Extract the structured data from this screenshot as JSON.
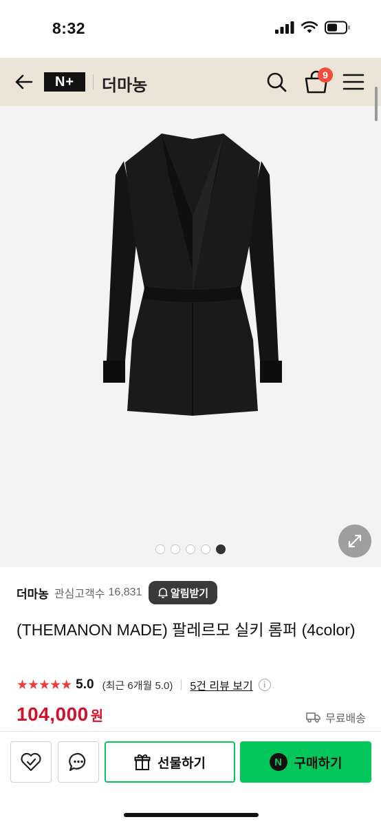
{
  "status_bar": {
    "time": "8:32"
  },
  "header": {
    "brand_logo": "N+",
    "store_name": "더마농",
    "cart_count": "9"
  },
  "gallery": {
    "total_images": 5,
    "active_index": 5
  },
  "seller": {
    "name": "더마농",
    "follower_label": "관심고객수",
    "follower_count": "16,831",
    "alert_button": "알림받기"
  },
  "product": {
    "title": "(THEMANON MADE) 팔레르모 실키 롬퍼 (4color)",
    "stars": "★★★★★",
    "rating": "5.0",
    "recent_rating": "(최근 6개월 5.0)",
    "review_link": "5건 리뷰 보기",
    "price": "104,000",
    "price_unit": "원",
    "shipping": "무료배송"
  },
  "bottom_bar": {
    "gift_label": "선물하기",
    "buy_label": "구매하기",
    "npay_letter": "N"
  },
  "colors": {
    "header_bg": "#ede4d8",
    "badge": "#f04d3b",
    "price": "#d7102a",
    "npay_green": "#03c75a",
    "star": "#e8403b"
  }
}
